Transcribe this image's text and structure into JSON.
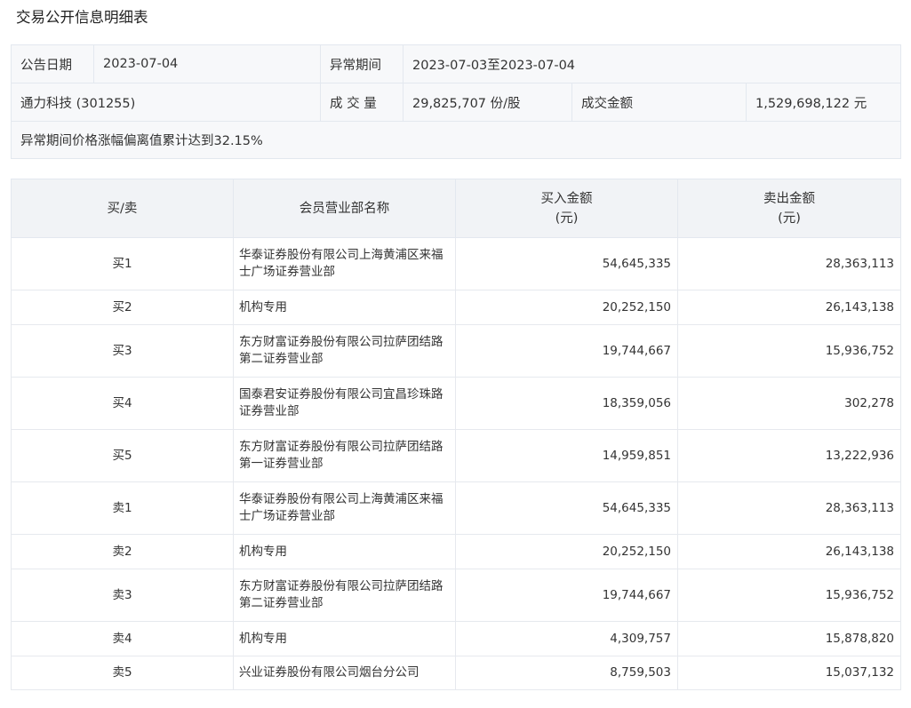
{
  "page": {
    "title": "交易公开信息明细表"
  },
  "info": {
    "date_label": "公告日期",
    "date_value": "2023-07-04",
    "period_label": "异常期间",
    "period_value": "2023-07-03至2023-07-04",
    "stock": "通力科技 (301255)",
    "volume_label": "成 交 量",
    "volume_value": "29,825,707 份/股",
    "amount_label": "成交金额",
    "amount_value": "1,529,698,122 元",
    "reason": "异常期间价格涨幅偏离值累计达到32.15%"
  },
  "table": {
    "headers": {
      "side": "买/卖",
      "member": "会员营业部名称",
      "buy_line1": "买入金额",
      "buy_line2": "(元)",
      "sell_line1": "卖出金额",
      "sell_line2": "(元)"
    },
    "rows": [
      {
        "side": "买1",
        "member": "华泰证券股份有限公司上海黄浦区来福士广场证券营业部",
        "buy": "54,645,335",
        "sell": "28,363,113"
      },
      {
        "side": "买2",
        "member": "机构专用",
        "buy": "20,252,150",
        "sell": "26,143,138"
      },
      {
        "side": "买3",
        "member": "东方财富证券股份有限公司拉萨团结路第二证券营业部",
        "buy": "19,744,667",
        "sell": "15,936,752"
      },
      {
        "side": "买4",
        "member": "国泰君安证券股份有限公司宜昌珍珠路证券营业部",
        "buy": "18,359,056",
        "sell": "302,278"
      },
      {
        "side": "买5",
        "member": "东方财富证券股份有限公司拉萨团结路第一证券营业部",
        "buy": "14,959,851",
        "sell": "13,222,936"
      },
      {
        "side": "卖1",
        "member": "华泰证券股份有限公司上海黄浦区来福士广场证券营业部",
        "buy": "54,645,335",
        "sell": "28,363,113"
      },
      {
        "side": "卖2",
        "member": "机构专用",
        "buy": "20,252,150",
        "sell": "26,143,138"
      },
      {
        "side": "卖3",
        "member": "东方财富证券股份有限公司拉萨团结路第二证券营业部",
        "buy": "19,744,667",
        "sell": "15,936,752"
      },
      {
        "side": "卖4",
        "member": "机构专用",
        "buy": "4,309,757",
        "sell": "15,878,820"
      },
      {
        "side": "卖5",
        "member": "兴业证券股份有限公司烟台分公司",
        "buy": "8,759,503",
        "sell": "15,037,132"
      }
    ]
  }
}
